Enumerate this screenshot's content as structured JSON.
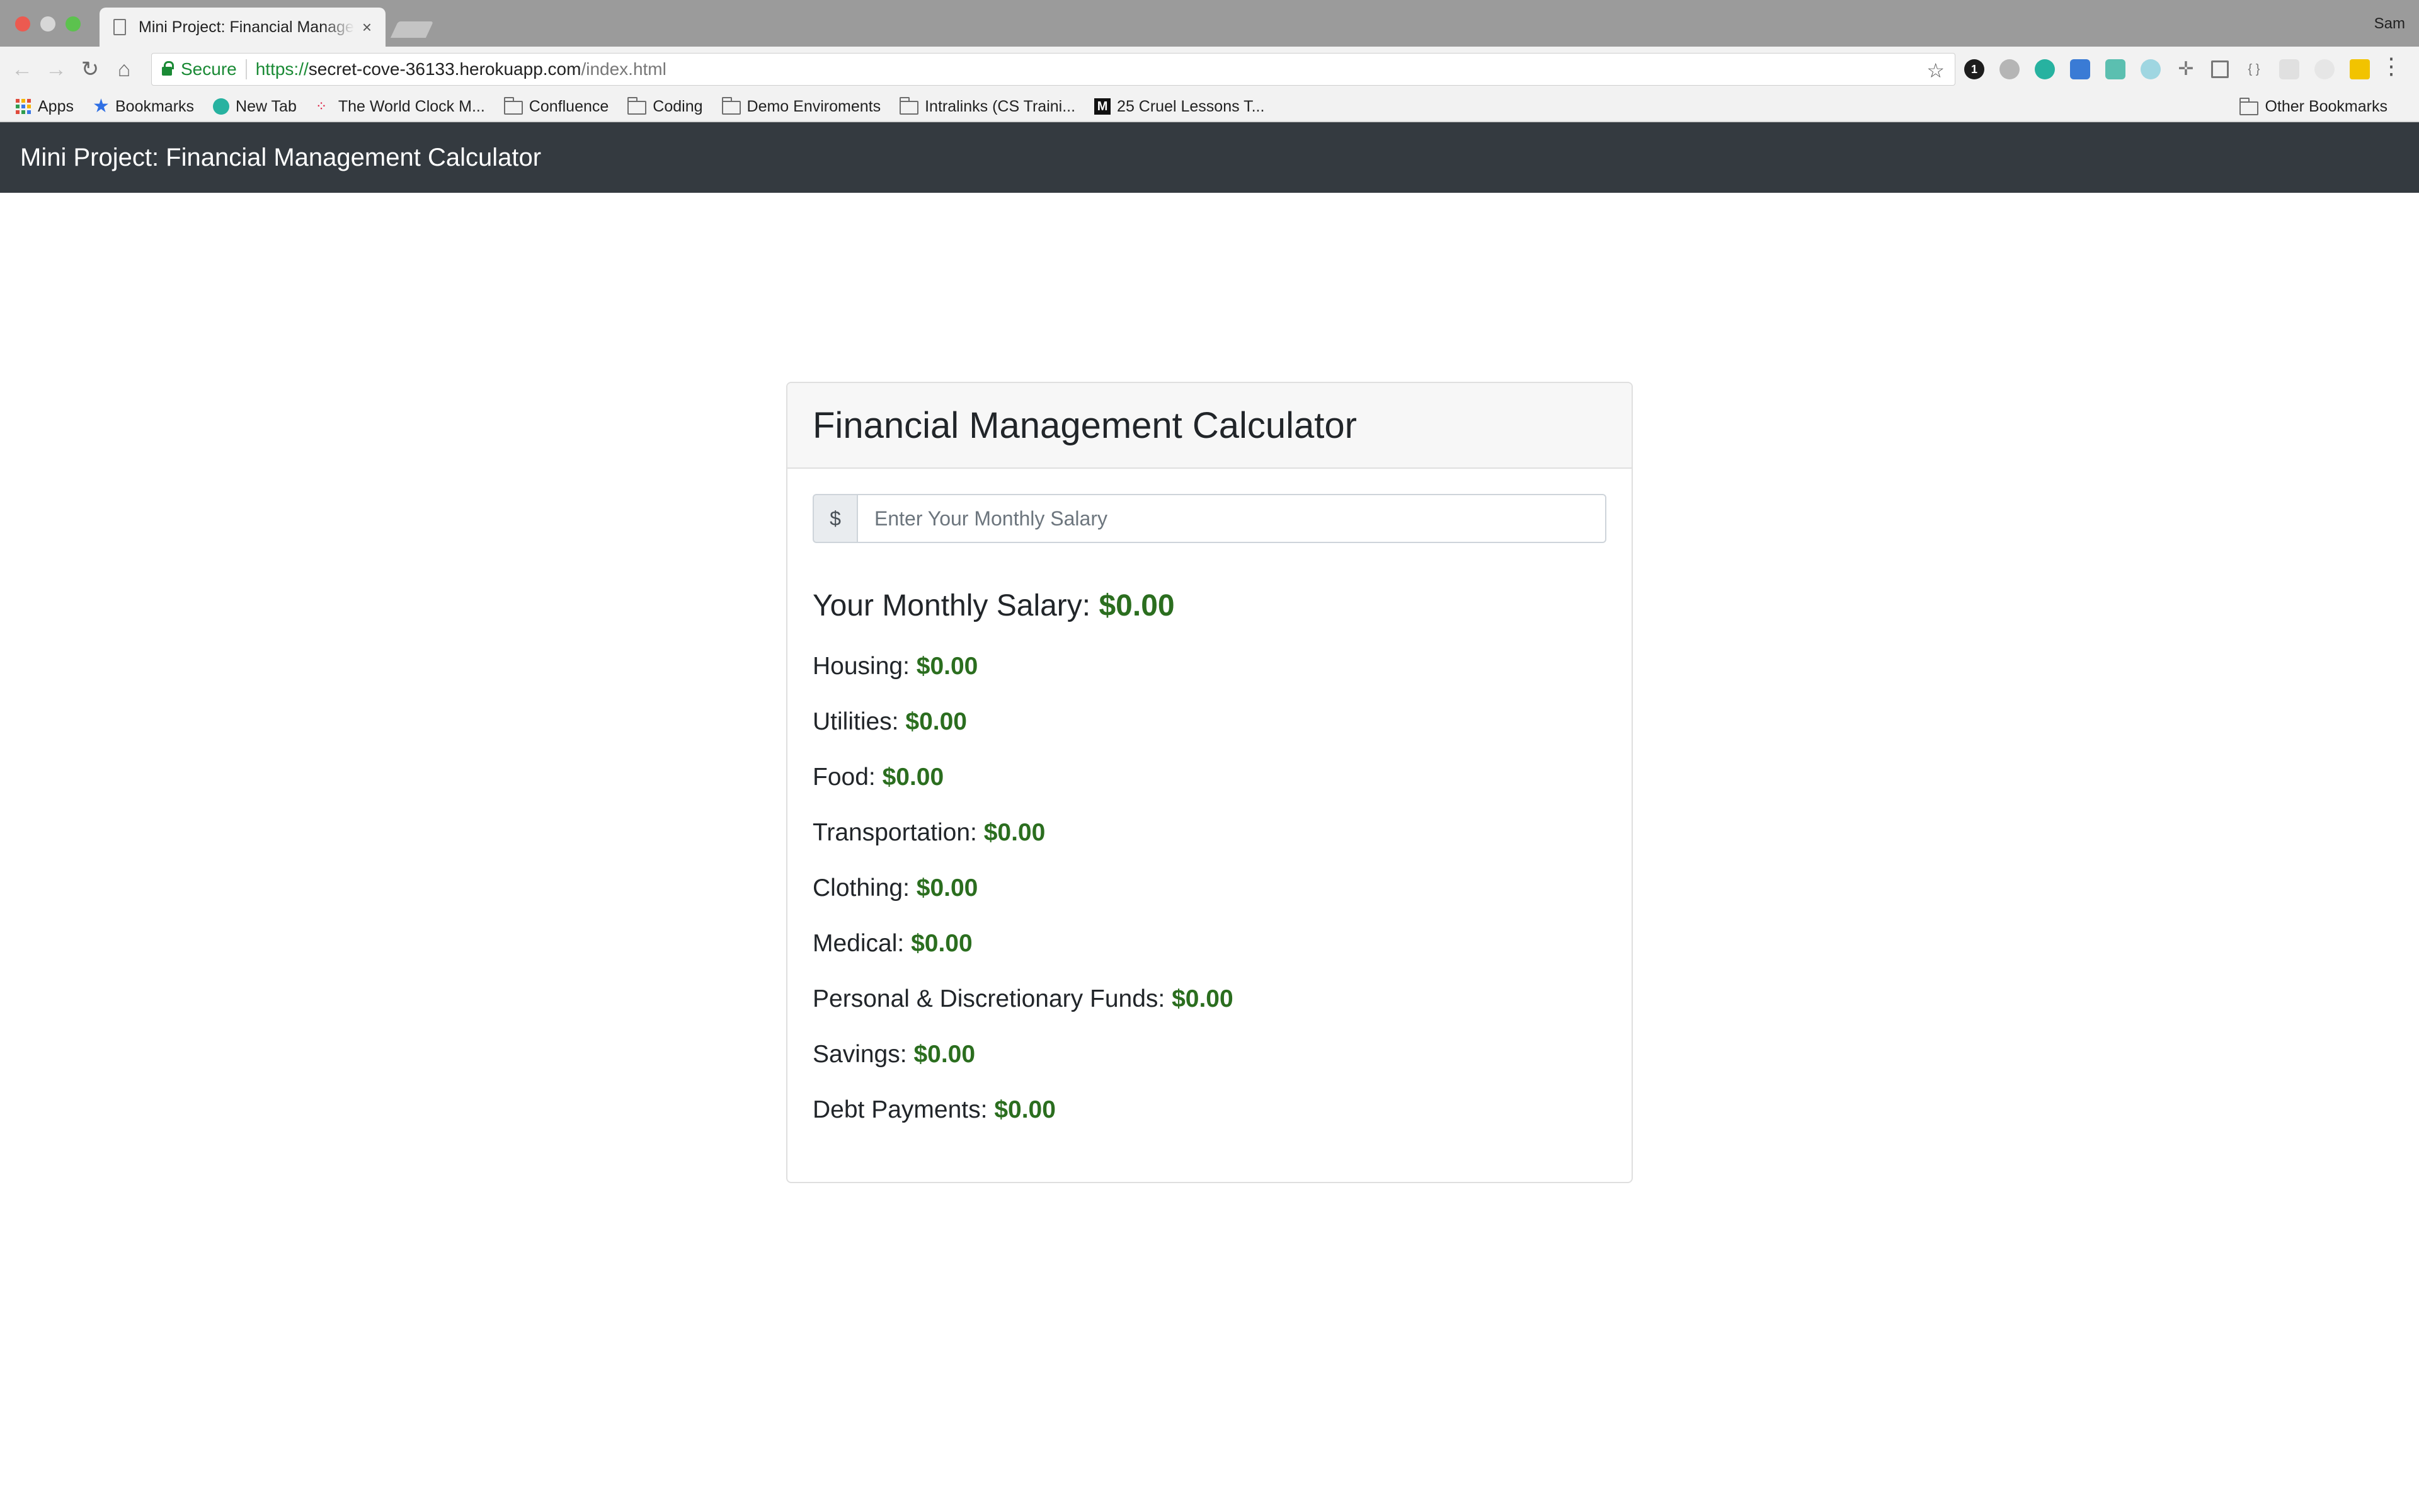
{
  "browser": {
    "tab_title": "Mini Project: Financial Management Calculator",
    "tab_close": "×",
    "profile_name": "Sam",
    "secure_label": "Secure",
    "url_scheme": "https://",
    "url_host": "secret-cove-36133.herokuapp.com",
    "url_path": "/index.html",
    "bookmarks": [
      {
        "label": "Apps",
        "icon": "apps-grid-icon"
      },
      {
        "label": "Bookmarks",
        "icon": "star-icon"
      },
      {
        "label": "New Tab",
        "icon": "teal-circle-icon"
      },
      {
        "label": "The World Clock M...",
        "icon": "clock-dots-icon"
      },
      {
        "label": "Confluence",
        "icon": "folder-icon"
      },
      {
        "label": "Coding",
        "icon": "folder-icon"
      },
      {
        "label": "Demo Enviroments",
        "icon": "folder-icon"
      },
      {
        "label": "Intralinks (CS Traini...",
        "icon": "folder-icon"
      },
      {
        "label": "25 Cruel Lessons T...",
        "icon": "medium-m-icon"
      }
    ],
    "other_bookmarks": "Other Bookmarks",
    "extension_badge": "1"
  },
  "navbar": {
    "brand": "Mini Project: Financial Management Calculator"
  },
  "card": {
    "title": "Financial Management Calculator",
    "input_prefix": "$",
    "input_placeholder": "Enter Your Monthly Salary",
    "input_value": "",
    "salary_label": "Your Monthly Salary:",
    "salary_value": "$0.00",
    "items": [
      {
        "label": "Housing:",
        "value": "$0.00"
      },
      {
        "label": "Utilities:",
        "value": "$0.00"
      },
      {
        "label": "Food:",
        "value": "$0.00"
      },
      {
        "label": "Transportation:",
        "value": "$0.00"
      },
      {
        "label": "Clothing:",
        "value": "$0.00"
      },
      {
        "label": "Medical:",
        "value": "$0.00"
      },
      {
        "label": "Personal & Discretionary Funds:",
        "value": "$0.00"
      },
      {
        "label": "Savings:",
        "value": "$0.00"
      },
      {
        "label": "Debt Payments:",
        "value": "$0.00"
      }
    ]
  },
  "colors": {
    "navbar_bg": "#343a40",
    "amount_green": "#2b6e1f",
    "secure_green": "#1a8a35"
  }
}
